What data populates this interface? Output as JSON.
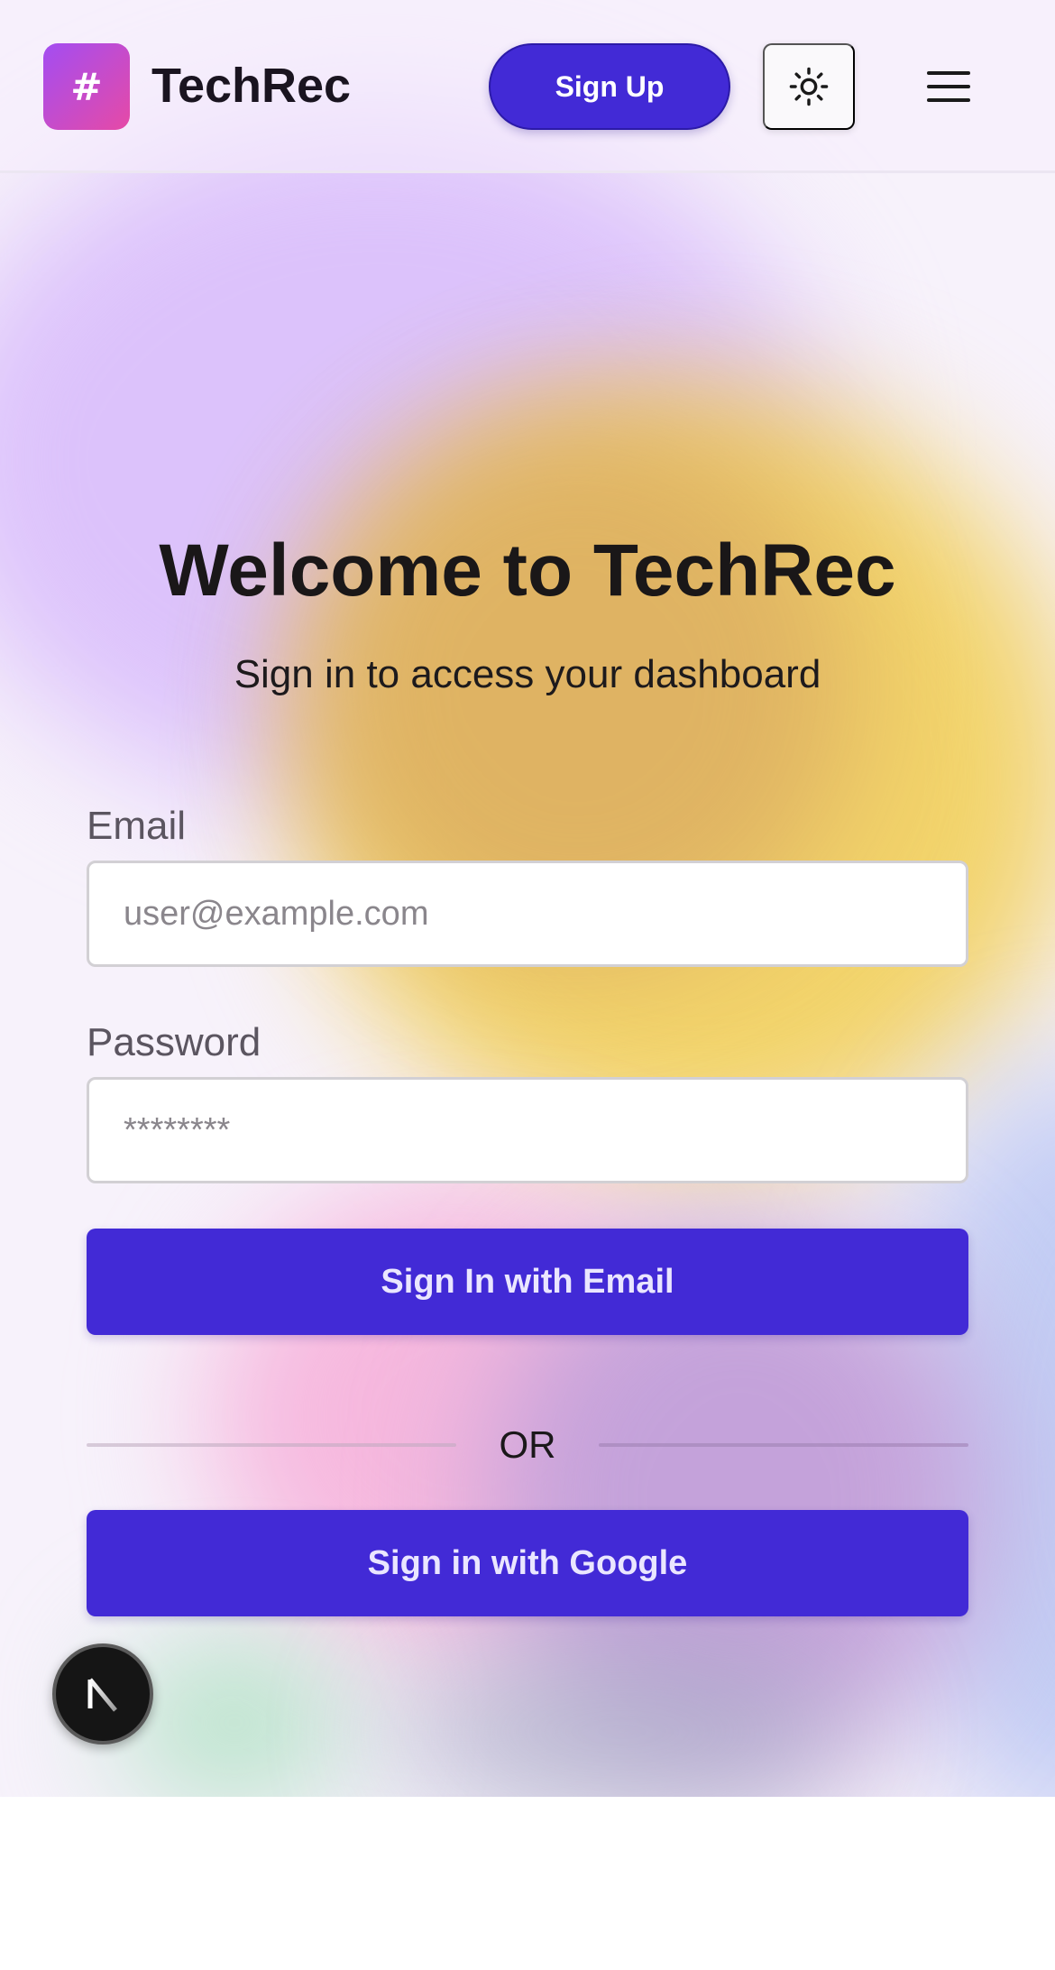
{
  "header": {
    "logo_symbol": "#",
    "brand": "TechRec",
    "signup_label": "Sign Up",
    "theme_icon": "sun-icon",
    "menu_icon": "hamburger-menu-icon"
  },
  "main": {
    "title": "Welcome to TechRec",
    "subtitle": "Sign in to access your dashboard",
    "email": {
      "label": "Email",
      "placeholder": "user@example.com",
      "value": ""
    },
    "password": {
      "label": "Password",
      "placeholder": "********",
      "value": ""
    },
    "email_signin_label": "Sign In with Email",
    "divider_text": "OR",
    "google_signin_label": "Sign in with Google"
  },
  "dev_badge": {
    "letter": "N",
    "icon": "nextjs-logo-icon"
  },
  "colors": {
    "primary": "#422ad6",
    "logo_gradient_start": "#a34df2",
    "logo_gradient_end": "#e64aa6",
    "text_dark": "#1a1718"
  }
}
